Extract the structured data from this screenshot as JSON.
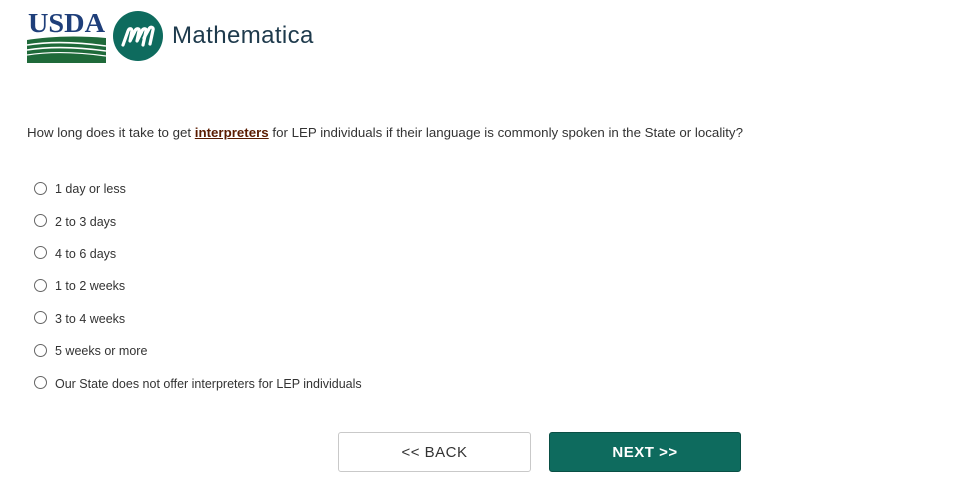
{
  "header": {
    "usda_logo_text": "USDA",
    "partner_name": "Mathematica",
    "colors": {
      "usda_green": "#1f6a3a",
      "usda_blue": "#1f3f7a",
      "mathematica_teal": "#0e6b5e",
      "mathematica_text": "#1e3a4c"
    }
  },
  "question": {
    "prefix": "How long does it take to get ",
    "term": "interpreters",
    "suffix": " for LEP individuals if their language is commonly spoken in the State or locality?"
  },
  "options": [
    {
      "label": "1 day or less",
      "selected": false
    },
    {
      "label": "2 to 3 days",
      "selected": false
    },
    {
      "label": "4 to 6 days",
      "selected": false
    },
    {
      "label": "1 to 2 weeks",
      "selected": false
    },
    {
      "label": "3 to 4 weeks",
      "selected": false
    },
    {
      "label": "5 weeks or more",
      "selected": false
    },
    {
      "label": "Our State does not offer interpreters for LEP individuals",
      "selected": false
    }
  ],
  "navigation": {
    "back_label": "<< BACK",
    "next_label": "NEXT >>",
    "next_color": "#0e6b5e"
  }
}
